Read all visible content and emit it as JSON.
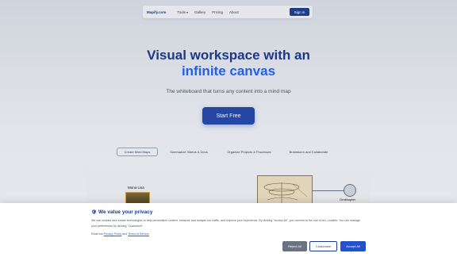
{
  "nav": {
    "logo": "Mapify.com",
    "links": [
      {
        "label": "Tools",
        "has_dropdown": true
      },
      {
        "label": "Gallery"
      },
      {
        "label": "Pricing"
      },
      {
        "label": "About"
      }
    ],
    "signin_label": "Sign in"
  },
  "hero": {
    "title_line1": "Visual workspace with an",
    "title_line2": "infinite canvas",
    "subtitle": "The whiteboard that turns any content into a mind map",
    "cta_label": "Start Free"
  },
  "tabs": [
    {
      "label": "Create Mind Maps",
      "active": true
    },
    {
      "label": "Summarize Videos & Docs",
      "active": false
    },
    {
      "label": "Organize Projects & Processes",
      "active": false
    },
    {
      "label": "Brainstorm and Collaborate",
      "active": false
    }
  ],
  "preview": {
    "node1_label": "Mona Lisa",
    "node2_label": "Ornithopter"
  },
  "cookie": {
    "icon": "🛡",
    "title": "We value your privacy",
    "body": "We use cookies and similar technologies to help personalize content, measure and analyze our traffic, and improve your experience. By clicking \"Accept All\", you consent to the use of ALL cookies. You can manage your preferences by clicking \"Customize\".",
    "read_prefix": "Read our",
    "privacy_link": "Privacy Policy",
    "and": "and",
    "terms_link": "Terms of Service",
    "reject_label": "Reject All",
    "customize_label": "Customize",
    "accept_label": "Accept All"
  },
  "colors": {
    "brand": "#1e3a8a",
    "accent": "#2563eb",
    "reject_bg": "#6b7280"
  }
}
